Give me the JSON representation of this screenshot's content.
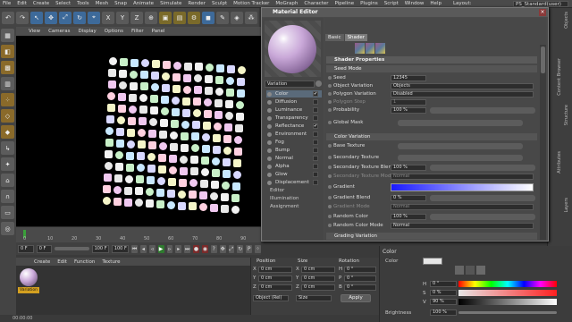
{
  "app": {
    "menu": [
      "File",
      "Edit",
      "Create",
      "Select",
      "Tools",
      "Mesh",
      "Snap",
      "Animate",
      "Simulate",
      "Render",
      "Sculpt",
      "Motion Tracker",
      "MoGraph",
      "Character",
      "Pipeline",
      "Plugins",
      "Script",
      "Window",
      "Help"
    ],
    "layout_label": "Layout:",
    "layout_value": "PS_Standard(user)"
  },
  "toolbar": {
    "axis_buttons": [
      "X",
      "Y",
      "Z"
    ]
  },
  "viewport": {
    "menu": [
      "View",
      "Cameras",
      "Display",
      "Options",
      "Filter",
      "Panel"
    ]
  },
  "timeline": {
    "ticks": [
      "0",
      "10",
      "20",
      "30",
      "40",
      "50",
      "60",
      "70",
      "80",
      "90"
    ],
    "start_field": "0 F",
    "start_field2": "0 F",
    "end_field": "100 F",
    "end_field2": "100 F"
  },
  "material_manager": {
    "menu": [
      "Create",
      "Edit",
      "Function",
      "Texture"
    ],
    "material_name": "Variation"
  },
  "coordinates": {
    "headers": [
      "Position",
      "Size",
      "Rotation"
    ],
    "rows": [
      {
        "axis": "X",
        "pos": "0 cm",
        "size_axis": "X",
        "size": "0 cm",
        "rot_axis": "H",
        "rot": "0 °"
      },
      {
        "axis": "Y",
        "pos": "0 cm",
        "size_axis": "Y",
        "size": "0 cm",
        "rot_axis": "P",
        "rot": "0 °"
      },
      {
        "axis": "Z",
        "pos": "0 cm",
        "size_axis": "Z",
        "size": "0 cm",
        "rot_axis": "B",
        "rot": "0 °"
      }
    ],
    "object_mode": "Object (Rel)",
    "size_mode": "Size",
    "apply_label": "Apply"
  },
  "status": {
    "time": "00:00:00"
  },
  "attributes": {
    "title": "Color",
    "color_label": "Color",
    "h_label": "H",
    "h_value": "0 °",
    "s_label": "S",
    "s_value": "0 %",
    "v_label": "V",
    "v_value": "90 %",
    "brightness_label": "Brightness",
    "brightness_value": "100 %"
  },
  "right_tabs": [
    "Objects",
    "Content Browser",
    "Structure",
    "Attributes",
    "Layers"
  ],
  "material_editor": {
    "title": "Material Editor",
    "material_name": "Variation",
    "channels": [
      {
        "label": "Color",
        "checked": "✔",
        "selected": true
      },
      {
        "label": "Diffusion",
        "checked": "",
        "selected": false
      },
      {
        "label": "Luminance",
        "checked": "",
        "selected": false
      },
      {
        "label": "Transparency",
        "checked": "",
        "selected": false
      },
      {
        "label": "Reflectance",
        "checked": "✔",
        "selected": false
      },
      {
        "label": "Environment",
        "checked": "",
        "selected": false
      },
      {
        "label": "Fog",
        "checked": "",
        "selected": false
      },
      {
        "label": "Bump",
        "checked": "",
        "selected": false
      },
      {
        "label": "Normal",
        "checked": "",
        "selected": false
      },
      {
        "label": "Alpha",
        "checked": "",
        "selected": false
      },
      {
        "label": "Glow",
        "checked": "",
        "selected": false
      },
      {
        "label": "Displacement",
        "checked": "",
        "selected": false
      }
    ],
    "extra_items": [
      "Editor",
      "Illumination",
      "Assignment"
    ],
    "tabs": [
      "Basic",
      "Shader"
    ],
    "shader_properties": "Shader Properties",
    "seed_mode": {
      "header": "Seed Mode",
      "seed_label": "Seed",
      "seed_value": "12345",
      "object_variation_label": "Object Variation",
      "object_variation_value": "Objects",
      "polygon_variation_label": "Polygon Variation",
      "polygon_variation_value": "Disabled",
      "polygon_step_label": "Polygon Step",
      "polygon_step_value": "1",
      "probability_label": "Probability",
      "probability_value": "100 %",
      "global_mask_label": "Global Mask"
    },
    "color_variation": {
      "header": "Color Variation",
      "base_texture_label": "Base Texture",
      "secondary_texture_label": "Secondary Texture",
      "secondary_blend_label": "Secondary Texture Blend",
      "secondary_blend_value": "100 %",
      "secondary_mode_label": "Secondary Texture Mode",
      "secondary_mode_value": "Normal",
      "gradient_label": "Gradient",
      "gradient_blend_label": "Gradient Blend",
      "gradient_blend_value": "0 %",
      "gradient_mode_label": "Gradient Mode",
      "gradient_mode_value": "Normal",
      "random_color_label": "Random Color",
      "random_color_value": "100 %",
      "random_color_mode_label": "Random Color Mode",
      "random_color_mode_value": "Normal"
    },
    "grading_header": "Grading Variation"
  }
}
